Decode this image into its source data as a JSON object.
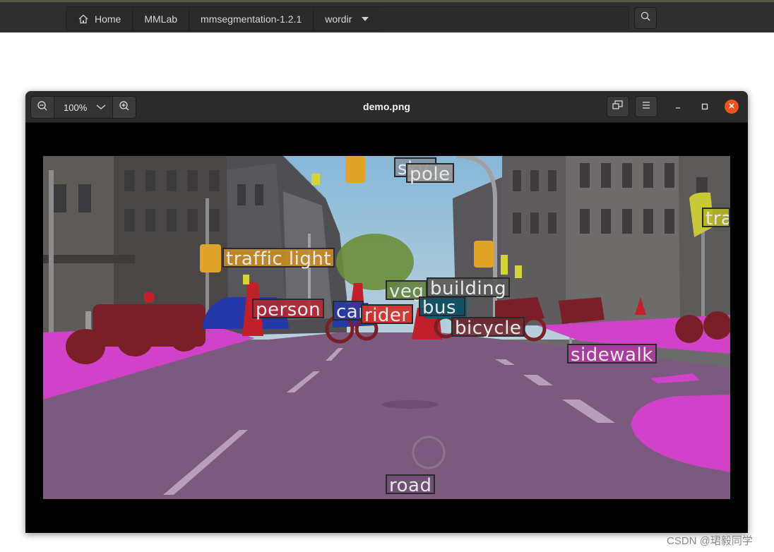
{
  "file_manager": {
    "breadcrumbs": [
      "Home",
      "MMLab",
      "mmsegmentation-1.2.1",
      "wordir"
    ],
    "home_icon": "home-icon",
    "dropdown_icon": "caret-down-icon",
    "search_icon": "search-icon"
  },
  "viewer": {
    "title": "demo.png",
    "zoom_level": "100%",
    "zoom_out_icon": "zoom-out-icon",
    "zoom_in_icon": "zoom-in-icon",
    "fit_icon": "fit-window-icon",
    "menu_icon": "hamburger-menu-icon",
    "minimize_icon": "minimize-icon",
    "maximize_icon": "maximize-icon",
    "close_icon": "close-icon"
  },
  "segmentation": {
    "labels": {
      "sky": "sky",
      "pole": "pole",
      "traffic_light": "traffic light",
      "traffic_light_right": "tra",
      "vegetation": "veg",
      "building": "building",
      "person": "person",
      "car": "car",
      "rider": "rider",
      "bus": "bus",
      "bicycle": "bicycle",
      "sidewalk": "sidewalk",
      "road": "road"
    },
    "colors": {
      "road": "#7c5a80",
      "sidewalk": "#d042c8",
      "bicycle": "#7a1f28",
      "person": "#c0202a",
      "rider": "#e0302a",
      "car": "#2438a8",
      "traffic_light": "#e0a42a",
      "traffic_sign": "#d4d43a",
      "vegetation": "#6b8e23",
      "pole": "#a0a0a0"
    }
  },
  "watermark": "CSDN @珺毅同学"
}
